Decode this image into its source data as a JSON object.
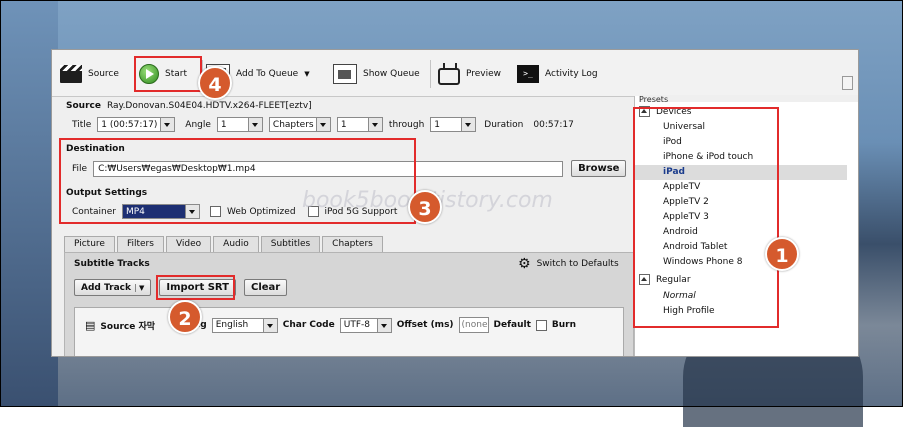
{
  "toolbar": {
    "source": "Source",
    "start": "Start",
    "add_to_queue": "Add To Queue",
    "show_queue": "Show Queue",
    "preview": "Preview",
    "activity_log": "Activity Log"
  },
  "source": {
    "label": "Source",
    "value": "Ray.Donovan.S04E04.HDTV.x264-FLEET[eztv]",
    "title_label": "Title",
    "title_value": "1 (00:57:17)",
    "angle_label": "Angle",
    "angle_value": "1",
    "chapters_select": "Chapters",
    "from_value": "1",
    "through_label": "through",
    "to_value": "1",
    "duration_label": "Duration",
    "duration_value": "00:57:17"
  },
  "destination": {
    "heading": "Destination",
    "file_label": "File",
    "file_value": "C:₩Users₩egas₩Desktop₩1.mp4",
    "browse": "Browse"
  },
  "output": {
    "heading": "Output Settings",
    "container_label": "Container",
    "container_value": "MP4",
    "web_optimized": "Web Optimized",
    "ipod_5g": "iPod 5G Support"
  },
  "tabs": [
    "Picture",
    "Filters",
    "Video",
    "Audio",
    "Subtitles",
    "Chapters"
  ],
  "subtitles": {
    "heading": "Subtitle Tracks",
    "switch_defaults": "Switch to Defaults",
    "add_track": "Add Track",
    "import_srt": "Import SRT",
    "clear": "Clear",
    "col_source": "Source 자막",
    "col_lang": "Lang",
    "lang_value": "English",
    "col_charcode": "Char Code",
    "charcode_value": "UTF-8",
    "col_offset": "Offset (ms)",
    "offset_value": "(none",
    "default_label": "Default",
    "burn_label": "Burn"
  },
  "presets": {
    "title": "Presets",
    "devices_group": "Devices",
    "devices": [
      "Universal",
      "iPod",
      "iPhone & iPod touch",
      "iPad",
      "AppleTV",
      "AppleTV 2",
      "AppleTV 3",
      "Android",
      "Android Tablet",
      "Windows Phone 8"
    ],
    "selected": "iPad",
    "regular_group": "Regular",
    "regular": [
      "Normal",
      "High Profile"
    ]
  },
  "annotations": {
    "badge1": "1",
    "badge2": "2",
    "badge3": "3",
    "badge4": "4",
    "watermark": "book5book.tistory.com",
    "color": "#e22b2b",
    "badge_color": "#d55a2d"
  }
}
